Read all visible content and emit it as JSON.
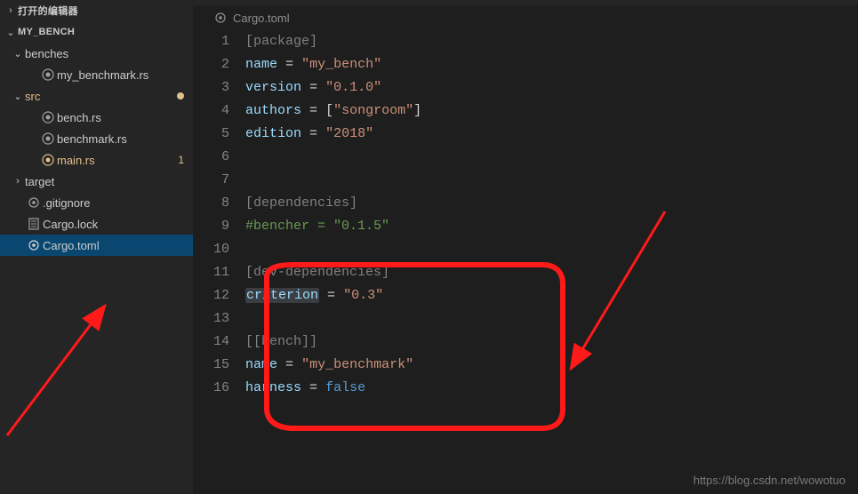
{
  "sidebar": {
    "openEditors": {
      "label": "打开的编辑器"
    },
    "project": {
      "label": "MY_BENCH"
    },
    "tree": {
      "benches": {
        "label": "benches"
      },
      "myBenchmark": {
        "label": "my_benchmark.rs"
      },
      "src": {
        "label": "src"
      },
      "benchRs": {
        "label": "bench.rs"
      },
      "benchmarkRs": {
        "label": "benchmark.rs"
      },
      "mainRs": {
        "label": "main.rs",
        "badge": "1"
      },
      "target": {
        "label": "target"
      },
      "gitignore": {
        "label": ".gitignore"
      },
      "cargoLock": {
        "label": "Cargo.lock"
      },
      "cargoToml": {
        "label": "Cargo.toml"
      }
    }
  },
  "editor": {
    "tabTitle": "Cargo.toml",
    "lines": [
      {
        "n": "1",
        "t": "[package]",
        "cls": "section"
      },
      {
        "n": "2",
        "t": "name = \"my_bench\"",
        "cls": "kv"
      },
      {
        "n": "3",
        "t": "version = \"0.1.0\"",
        "cls": "kv"
      },
      {
        "n": "4",
        "t": "authors = [\"songroom\"]",
        "cls": "kv-arr"
      },
      {
        "n": "5",
        "t": "edition = \"2018\"",
        "cls": "kv"
      },
      {
        "n": "6",
        "t": ""
      },
      {
        "n": "7",
        "t": ""
      },
      {
        "n": "8",
        "t": "[dependencies]",
        "cls": "section"
      },
      {
        "n": "9",
        "t": "#bencher = \"0.1.5\"",
        "cls": "comment"
      },
      {
        "n": "10",
        "t": ""
      },
      {
        "n": "11",
        "t": "[dev-dependencies]",
        "cls": "section"
      },
      {
        "n": "12",
        "t": "criterion = \"0.3\"",
        "cls": "kv",
        "highlightKey": true
      },
      {
        "n": "13",
        "t": ""
      },
      {
        "n": "14",
        "t": "[[bench]]",
        "cls": "section"
      },
      {
        "n": "15",
        "t": "name = \"my_benchmark\"",
        "cls": "kv"
      },
      {
        "n": "16",
        "t": "harness = false",
        "cls": "kv-bool"
      }
    ]
  },
  "watermark": "https://blog.csdn.net/wowotuo"
}
